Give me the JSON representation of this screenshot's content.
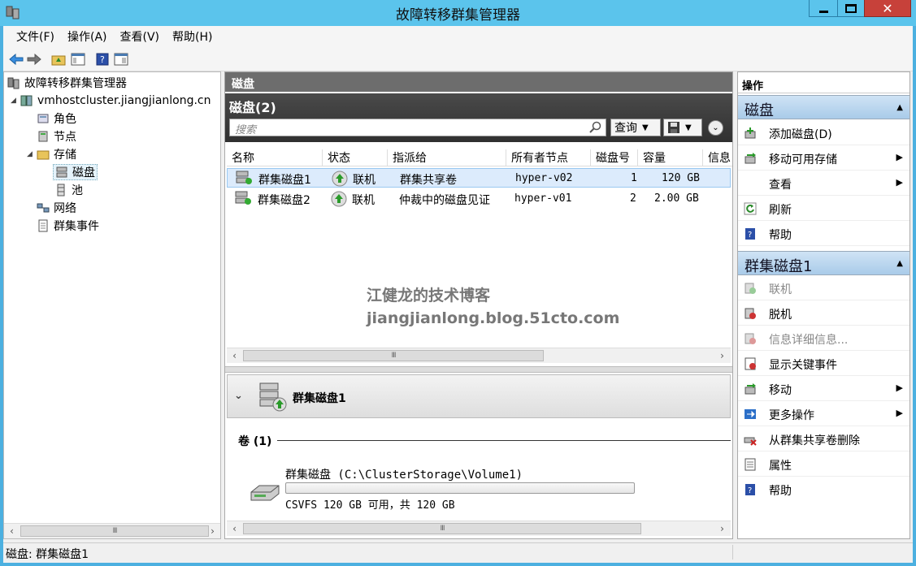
{
  "window": {
    "title": "故障转移群集管理器"
  },
  "menu": [
    "文件(F)",
    "操作(A)",
    "查看(V)",
    "帮助(H)"
  ],
  "tree": {
    "root": "故障转移群集管理器",
    "cluster": "vmhostcluster.jiangjianlong.cn",
    "items": {
      "roles": "角色",
      "nodes": "节点",
      "storage": "存储",
      "disks": "磁盘",
      "pools": "池",
      "network": "网络",
      "events": "群集事件"
    }
  },
  "middle": {
    "header": "磁盘",
    "subheader": "磁盘(2)",
    "search_placeholder": "搜索",
    "query_label": "查询",
    "columns": [
      "名称",
      "状态",
      "指派给",
      "所有者节点",
      "磁盘号",
      "容量",
      "信息"
    ],
    "rows": [
      {
        "name": "群集磁盘1",
        "status": "联机",
        "assigned": "群集共享卷",
        "owner": "hyper-v02",
        "disk": "1",
        "capacity": "120 GB"
      },
      {
        "name": "群集磁盘2",
        "status": "联机",
        "assigned": "仲裁中的磁盘见证",
        "owner": "hyper-v01",
        "disk": "2",
        "capacity": "2.00 GB"
      }
    ],
    "watermark": {
      "line1": "江健龙的技术博客",
      "line2": "jiangjianlong.blog.51cto.com"
    },
    "detail": {
      "title": "群集磁盘1",
      "volumes_label": "卷 (1)",
      "volume_name": "群集磁盘 (C:\\ClusterStorage\\Volume1)",
      "volume_info": "CSVFS 120 GB 可用，共 120 GB"
    }
  },
  "actions": {
    "header": "操作",
    "section1": "磁盘",
    "section1_items": [
      "添加磁盘(D)",
      "移动可用存储",
      "查看",
      "刷新",
      "帮助"
    ],
    "section2": "群集磁盘1",
    "section2_items": [
      "联机",
      "脱机",
      "信息详细信息...",
      "显示关键事件",
      "移动",
      "更多操作",
      "从群集共享卷删除",
      "属性",
      "帮助"
    ]
  },
  "status_bar": "磁盘: 群集磁盘1",
  "colors": {
    "titlebar": "#5bc4ec",
    "close": "#c7413a",
    "section": "#bcd7ef",
    "selected_row": "#dcebfc"
  }
}
